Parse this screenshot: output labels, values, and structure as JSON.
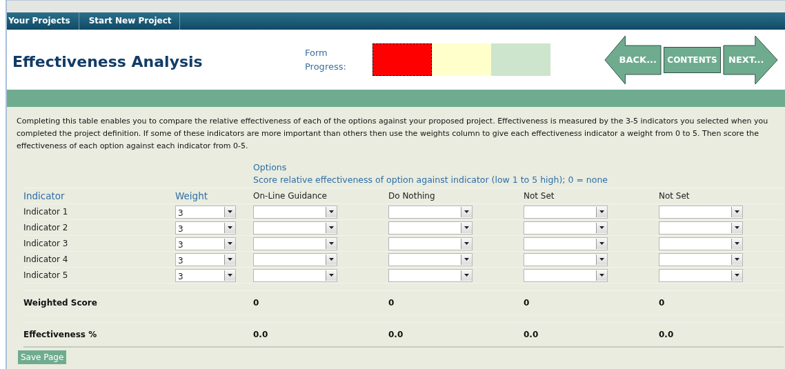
{
  "nav_tabs": [
    {
      "label": "Your Projects"
    },
    {
      "label": "Start New Project"
    }
  ],
  "header": {
    "title": "Effectiveness Analysis",
    "progress_label": "Form Progress:",
    "progress_segments": [
      {
        "color": "#ff0000",
        "selected": true
      },
      {
        "color": "#ffffcc",
        "selected": false
      },
      {
        "color": "#cce5cc",
        "selected": false
      }
    ],
    "nav_buttons": [
      {
        "kind": "back",
        "label": "BACK..."
      },
      {
        "kind": "contents",
        "label": "CONTENTS"
      },
      {
        "kind": "next",
        "label": "NEXT..."
      }
    ]
  },
  "intro": "Completing this table enables you to compare the relative effectiveness of each of the options against your proposed project. Effectiveness is measured by the 3-5 indicators you selected when you completed the project definition. If some of these indicators are more important than others then use the weights column to give each effectiveness indicator a weight from 0 to 5. Then score the effectiveness of each option against each indicator from 0-5.",
  "table": {
    "options_heading": "Options",
    "options_hint": "Score relative effectiveness of option against indicator (low 1 to 5 high); 0 = none",
    "indicator_heading": "Indicator",
    "weight_heading": "Weight",
    "options": [
      "On-Line Guidance",
      "Do Nothing",
      "Not Set",
      "Not Set"
    ],
    "rows": [
      {
        "indicator": "Indicator 1",
        "weight": "3"
      },
      {
        "indicator": "Indicator 2",
        "weight": "3"
      },
      {
        "indicator": "Indicator 3",
        "weight": "3"
      },
      {
        "indicator": "Indicator 4",
        "weight": "3"
      },
      {
        "indicator": "Indicator 5",
        "weight": "3"
      }
    ],
    "weighted_score": {
      "label": "Weighted Score",
      "values": [
        "0",
        "0",
        "0",
        "0"
      ]
    },
    "effectiveness": {
      "label": "Effectiveness %",
      "values": [
        "0.0",
        "0.0",
        "0.0",
        "0.0"
      ]
    }
  },
  "save_button": "Save Page"
}
